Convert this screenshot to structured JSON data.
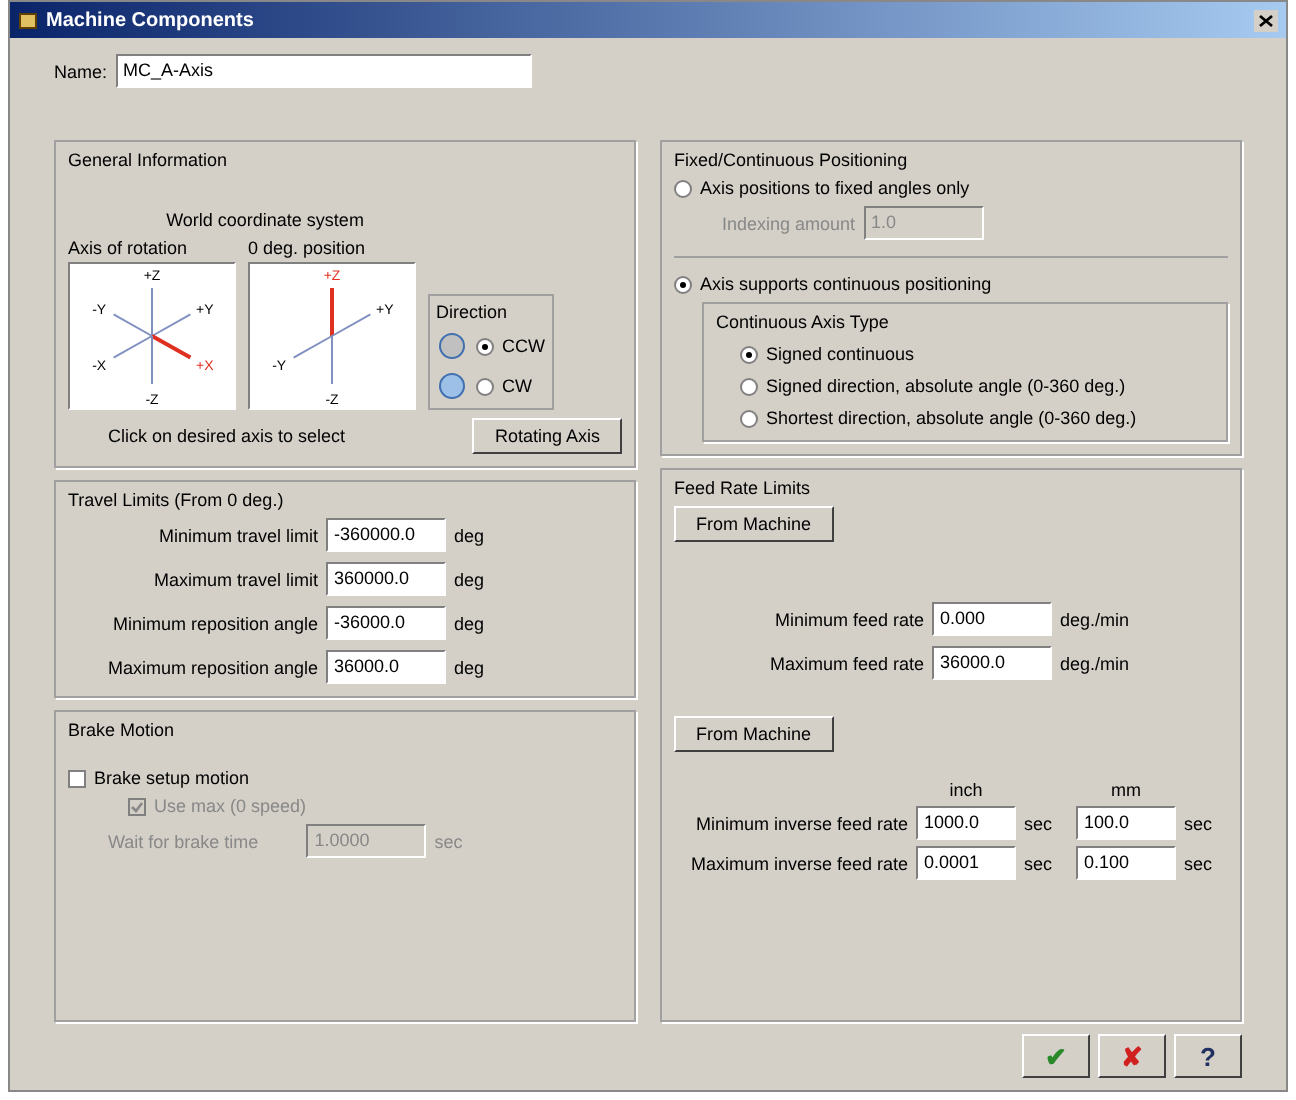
{
  "window": {
    "title": "Machine Components"
  },
  "name_field": {
    "label": "Name:",
    "value": "MC_A-Axis"
  },
  "general": {
    "title": "General Information",
    "caption": "World coordinate system",
    "diagrams": [
      {
        "title": "Axis of rotation",
        "labels": [
          {
            "text": "+Z",
            "kind": "up",
            "selected": false
          },
          {
            "text": "-Y",
            "kind": "upleft",
            "selected": false
          },
          {
            "text": "+Y",
            "kind": "upright",
            "selected": false
          },
          {
            "text": "-X",
            "kind": "downleft",
            "selected": false
          },
          {
            "text": "+X",
            "kind": "downright",
            "selected": true
          },
          {
            "text": "-Z",
            "kind": "down",
            "selected": false
          }
        ]
      },
      {
        "title": "0 deg. position",
        "labels": [
          {
            "text": "+Z",
            "kind": "up",
            "selected": true
          },
          {
            "text": "+Y",
            "kind": "upright",
            "selected": false
          },
          {
            "text": "-Y",
            "kind": "downleft",
            "selected": false
          },
          {
            "text": "-Z",
            "kind": "down",
            "selected": false
          }
        ]
      }
    ],
    "hint": "Click on desired axis to select",
    "direction": {
      "title": "Direction",
      "options": [
        {
          "label": "CCW",
          "selected": true
        },
        {
          "label": "CW",
          "selected": false
        }
      ]
    },
    "button": "Rotating Axis"
  },
  "travel": {
    "title": "Travel Limits (From 0 deg.)",
    "rows": [
      {
        "label": "Minimum travel limit",
        "value": "-360000.0",
        "unit": "deg"
      },
      {
        "label": "Maximum travel limit",
        "value": "360000.0",
        "unit": "deg"
      },
      {
        "label": "Minimum reposition angle",
        "value": "-36000.0",
        "unit": "deg"
      },
      {
        "label": "Maximum reposition angle",
        "value": "36000.0",
        "unit": "deg"
      }
    ]
  },
  "brake": {
    "title": "Brake Motion",
    "setup": {
      "label": "Brake setup motion",
      "checked": false
    },
    "use_max": {
      "label": "Use max (0 speed)",
      "checked": true,
      "disabled": true
    },
    "wait": {
      "label": "Wait for brake time",
      "value": "1.0000",
      "unit": "sec",
      "disabled": true
    }
  },
  "positioning": {
    "title": "Fixed/Continuous Positioning",
    "fixed": {
      "label": "Axis positions to fixed angles only",
      "selected": false
    },
    "indexing": {
      "label": "Indexing amount",
      "value": "1.0",
      "disabled": true
    },
    "continuous": {
      "label": "Axis supports continuous positioning",
      "selected": true
    },
    "type_title": "Continuous Axis Type",
    "types": [
      {
        "label": "Signed continuous",
        "selected": true
      },
      {
        "label": "Signed direction, absolute angle (0-360 deg.)",
        "selected": false
      },
      {
        "label": "Shortest direction, absolute angle (0-360 deg.)",
        "selected": false
      }
    ]
  },
  "feed": {
    "title": "Feed Rate Limits",
    "button": "From Machine",
    "rows": [
      {
        "label": "Minimum feed rate",
        "value": "0.000",
        "unit": "deg./min"
      },
      {
        "label": "Maximum feed rate",
        "value": "36000.0",
        "unit": "deg./min"
      }
    ],
    "button2": "From Machine",
    "columns": [
      "inch",
      "mm"
    ],
    "inverse_rows": [
      {
        "label": "Minimum inverse feed rate",
        "values": [
          "1000.0",
          "100.0"
        ],
        "units": [
          "sec",
          "sec"
        ]
      },
      {
        "label": "Maximum inverse feed rate",
        "values": [
          "0.0001",
          "0.100"
        ],
        "units": [
          "sec",
          "sec"
        ]
      }
    ]
  },
  "buttons": [
    {
      "kind": "ok",
      "label": "✔"
    },
    {
      "kind": "cancel",
      "label": "✘"
    },
    {
      "kind": "help",
      "label": "?"
    }
  ]
}
